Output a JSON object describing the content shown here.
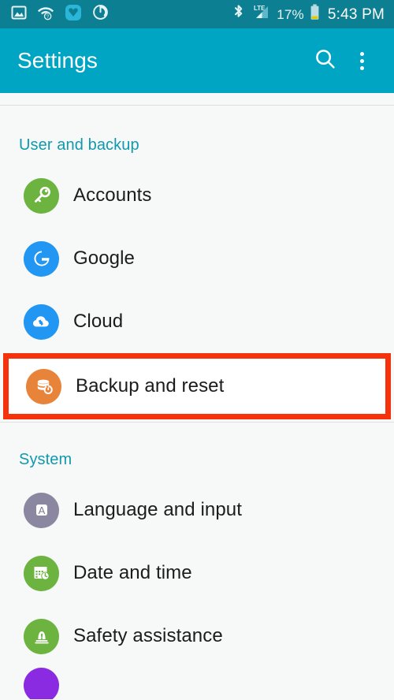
{
  "status_bar": {
    "background_color": "#0d7f92",
    "left_icons": [
      {
        "name": "gallery-image-icon",
        "label": "Gallery"
      },
      {
        "name": "wifi-question-icon",
        "label": "Wi-Fi unknown"
      },
      {
        "name": "download-heart-icon",
        "label": "Download"
      },
      {
        "name": "sync-circle-icon",
        "label": "Sync"
      }
    ],
    "right_icons": [
      {
        "name": "bluetooth-icon",
        "label": "Bluetooth"
      },
      {
        "name": "lte-signal-icon",
        "label": "LTE"
      }
    ],
    "network_type": "LTE",
    "battery_percent": "17%",
    "battery_level": 17,
    "battery_color": "#e8c800",
    "clock": "5:43 PM"
  },
  "app_bar": {
    "title": "Settings",
    "background_color": "#00a5c4",
    "search_icon": "search-icon",
    "overflow_icon": "overflow-menu-icon"
  },
  "sections": [
    {
      "header": "User and backup",
      "items": [
        {
          "label": "Accounts",
          "icon": "key-icon",
          "icon_color": "#6cb33f",
          "highlighted": false
        },
        {
          "label": "Google",
          "icon": "google-g-icon",
          "icon_color": "#2196f3",
          "highlighted": false
        },
        {
          "label": "Cloud",
          "icon": "cloud-sync-icon",
          "icon_color": "#2196f3",
          "highlighted": false
        },
        {
          "label": "Backup and reset",
          "icon": "backup-reset-icon",
          "icon_color": "#e8833a",
          "highlighted": true,
          "highlight_color": "#f4320c"
        }
      ]
    },
    {
      "header": "System",
      "items": [
        {
          "label": "Language and input",
          "icon": "language-a-icon",
          "icon_color": "#8b87a0",
          "highlighted": false
        },
        {
          "label": "Date and time",
          "icon": "calendar-clock-icon",
          "icon_color": "#6cb33f",
          "highlighted": false
        },
        {
          "label": "Safety assistance",
          "icon": "safety-beacon-icon",
          "icon_color": "#6cb33f",
          "highlighted": false
        },
        {
          "label": "",
          "icon": "accessibility-icon",
          "icon_color": "#8a2be2",
          "highlighted": false,
          "partial": true
        }
      ]
    }
  ],
  "colors": {
    "accent": "#00a5c4",
    "section_header": "#1199ae",
    "page_background": "#f7f8f8",
    "primary_text": "#1c1c1c",
    "highlight": "#f4320c"
  }
}
